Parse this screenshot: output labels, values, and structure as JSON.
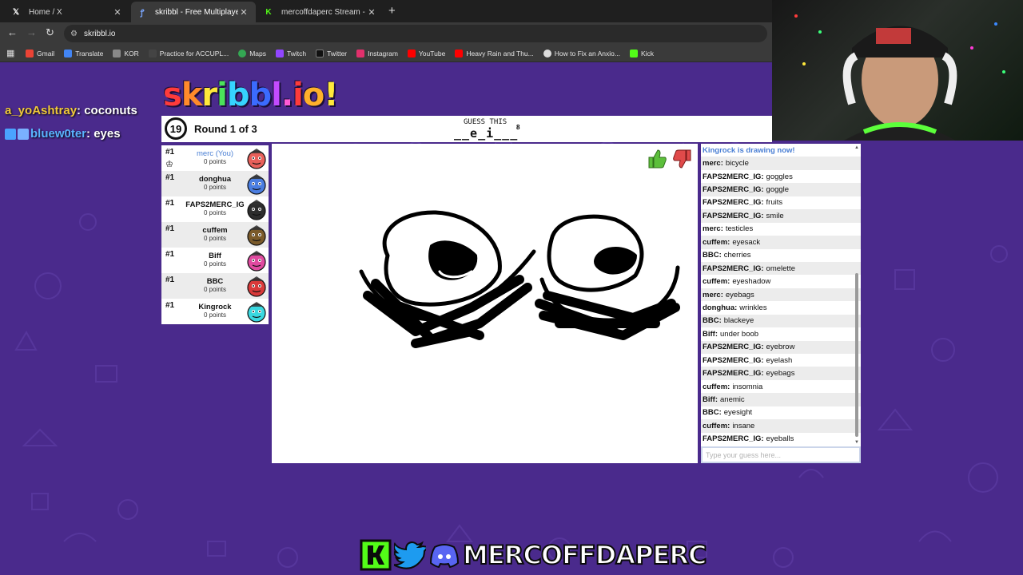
{
  "browser": {
    "tabs": [
      {
        "title": "Home / X",
        "icon": "x-logo-icon",
        "active": false
      },
      {
        "title": "skribbl - Free Multiplayer Draw",
        "icon": "skribbl-favicon-icon",
        "active": true
      },
      {
        "title": "mercoffdaperc Stream - Watch",
        "icon": "kick-favicon-icon",
        "active": false
      }
    ],
    "url": "skribbl.io",
    "bookmarks": [
      {
        "label": "Gmail",
        "color": "#ea4335"
      },
      {
        "label": "Translate",
        "color": "#4285f4"
      },
      {
        "label": "KOR",
        "color": "#888888"
      },
      {
        "label": "Practice for ACCUPL...",
        "color": "#444444"
      },
      {
        "label": "Maps",
        "color": "#34a853"
      },
      {
        "label": "Twitch",
        "color": "#9146ff"
      },
      {
        "label": "Twitter",
        "color": "#111111"
      },
      {
        "label": "Instagram",
        "color": "#e1306c"
      },
      {
        "label": "YouTube",
        "color": "#ff0000"
      },
      {
        "label": "Heavy Rain and Thu...",
        "color": "#ff0000"
      },
      {
        "label": "How to Fix an Anxio...",
        "color": "#dddddd"
      },
      {
        "label": "Kick",
        "color": "#53fc18"
      }
    ]
  },
  "overlay": {
    "chat": [
      {
        "user": "a_yoAshtray",
        "message": " : coconuts"
      },
      {
        "user": "bluew0ter",
        "message": " : eyes"
      }
    ]
  },
  "game": {
    "logo": [
      "s",
      "k",
      "r",
      "i",
      "b",
      "b",
      "l",
      ".",
      "i",
      "o",
      "!"
    ],
    "logo_colors": [
      "#ff3b3b",
      "#ff8a2b",
      "#ffe83b",
      "#4be35a",
      "#36d3ff",
      "#3b6bff",
      "#c34bff",
      "#ff5bd5",
      "#ff3b3b",
      "#ffb12b",
      "#ffe83b"
    ],
    "timer": "19",
    "round": "Round 1 of 3",
    "guess_title": "GUESS THIS",
    "word_hint": "__e_i___",
    "word_length": "8",
    "players": [
      {
        "rank": "#1",
        "name": "merc (You)",
        "points": "0 points",
        "is_me": true,
        "owner": true,
        "avatar_color": "#e8605a"
      },
      {
        "rank": "#1",
        "name": "donghua",
        "points": "0 points",
        "is_me": false,
        "owner": false,
        "avatar_color": "#4a7de0"
      },
      {
        "rank": "#1",
        "name": "FAPS2MERC_IG",
        "points": "0 points",
        "is_me": false,
        "owner": false,
        "avatar_color": "#2d2d2d"
      },
      {
        "rank": "#1",
        "name": "cuffem",
        "points": "0 points",
        "is_me": false,
        "owner": false,
        "avatar_color": "#7a5a2a"
      },
      {
        "rank": "#1",
        "name": "Biff",
        "points": "0 points",
        "is_me": false,
        "owner": false,
        "avatar_color": "#e04aa0"
      },
      {
        "rank": "#1",
        "name": "BBC",
        "points": "0 points",
        "is_me": false,
        "owner": false,
        "avatar_color": "#d83a3a"
      },
      {
        "rank": "#1",
        "name": "Kingrock",
        "points": "0 points",
        "is_me": false,
        "owner": false,
        "avatar_color": "#3ad8e0"
      }
    ],
    "chat": [
      {
        "system": true,
        "text": "Kingrock is drawing now!"
      },
      {
        "user": "merc:",
        "text": "bicycle"
      },
      {
        "user": "FAPS2MERC_IG:",
        "text": "goggles"
      },
      {
        "user": "FAPS2MERC_IG:",
        "text": "goggle"
      },
      {
        "user": "FAPS2MERC_IG:",
        "text": "fruits"
      },
      {
        "user": "FAPS2MERC_IG:",
        "text": "smile"
      },
      {
        "user": "merc:",
        "text": "testicles"
      },
      {
        "user": "cuffem:",
        "text": "eyesack"
      },
      {
        "user": "BBC:",
        "text": "cherries"
      },
      {
        "user": "FAPS2MERC_IG:",
        "text": "omelette"
      },
      {
        "user": "cuffem:",
        "text": "eyeshadow"
      },
      {
        "user": "merc:",
        "text": "eyebags"
      },
      {
        "user": "donghua:",
        "text": "wrinkles"
      },
      {
        "user": "BBC:",
        "text": "blackeye"
      },
      {
        "user": "Biff:",
        "text": "under boob"
      },
      {
        "user": "FAPS2MERC_IG:",
        "text": "eyebrow"
      },
      {
        "user": "FAPS2MERC_IG:",
        "text": "eyelash"
      },
      {
        "user": "FAPS2MERC_IG:",
        "text": "eyebags"
      },
      {
        "user": "cuffem:",
        "text": "insomnia"
      },
      {
        "user": "Biff:",
        "text": "anemic"
      },
      {
        "user": "BBC:",
        "text": "eyesight"
      },
      {
        "user": "cuffem:",
        "text": "insane"
      },
      {
        "user": "FAPS2MERC_IG:",
        "text": "eyeballs"
      }
    ],
    "chat_placeholder": "Type your guess here..."
  },
  "footer": {
    "brand": "MERCOFFDAPERC",
    "icons": [
      "kick-icon",
      "twitter-bird-icon",
      "discord-icon"
    ]
  }
}
